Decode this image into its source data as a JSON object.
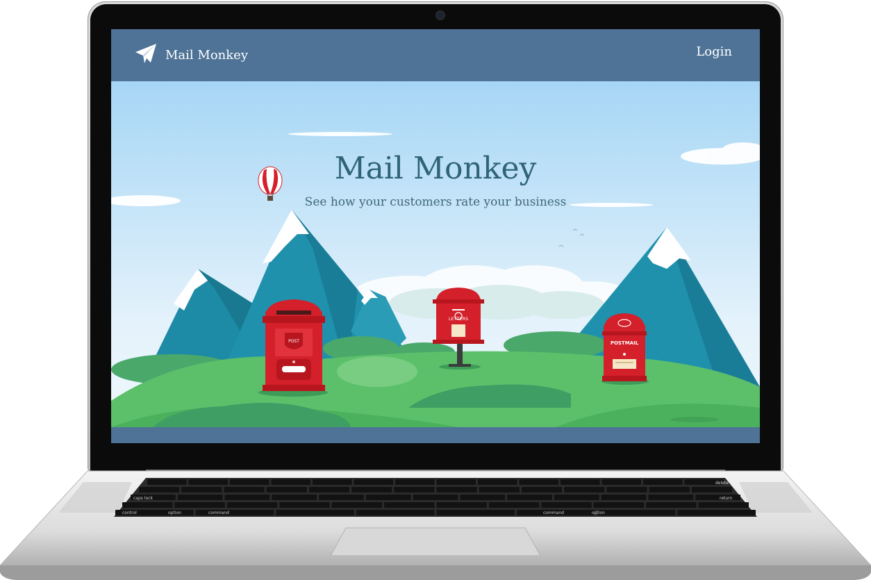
{
  "app": {
    "brand_name": "Mail Monkey",
    "login_label": "Login",
    "brand_icon": "paper-plane-icon"
  },
  "hero": {
    "title": "Mail Monkey",
    "subtitle": "See how your customers rate your business"
  },
  "mailboxes": [
    {
      "label": "POST"
    },
    {
      "label": "LETTERS"
    },
    {
      "label": "POSTMAIL"
    }
  ],
  "keyboard": {
    "keys": [
      "delete",
      "caps lock",
      "return",
      "control",
      "option",
      "command",
      "command",
      "option"
    ]
  },
  "colors": {
    "header": "#4e7397",
    "title": "#2f6377",
    "mailbox_red": "#d3202a",
    "grass": "#5cc06b",
    "mountain": "#1f8fa8"
  }
}
